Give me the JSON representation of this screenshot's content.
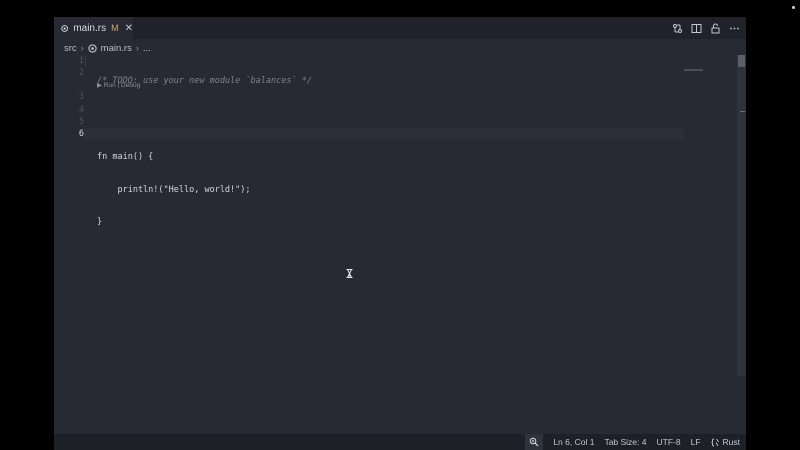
{
  "tab": {
    "filename": "main.rs",
    "modified_marker": "M",
    "close_glyph": "✕"
  },
  "breadcrumb": {
    "folder": "src",
    "file": "main.rs",
    "more": "..."
  },
  "editor": {
    "line_numbers": [
      "1",
      "2",
      "3",
      "4",
      "5",
      "6"
    ],
    "codelens": "▶ Run | Debug",
    "lines": [
      "/* TODO: use your new module `balances` */",
      "",
      "fn main() {",
      "    println!(\"Hello, world!\");",
      "}",
      ""
    ]
  },
  "statusbar": {
    "position": "Ln 6, Col 1",
    "tab_size": "Tab Size: 4",
    "encoding": "UTF-8",
    "eol": "LF",
    "language": "Rust"
  },
  "colors": {
    "editor_bg": "#272a32",
    "tabbar_bg": "#1f2228",
    "statusbar_bg": "#1d2026",
    "modified": "#c9a867",
    "comment": "#7d828c"
  }
}
